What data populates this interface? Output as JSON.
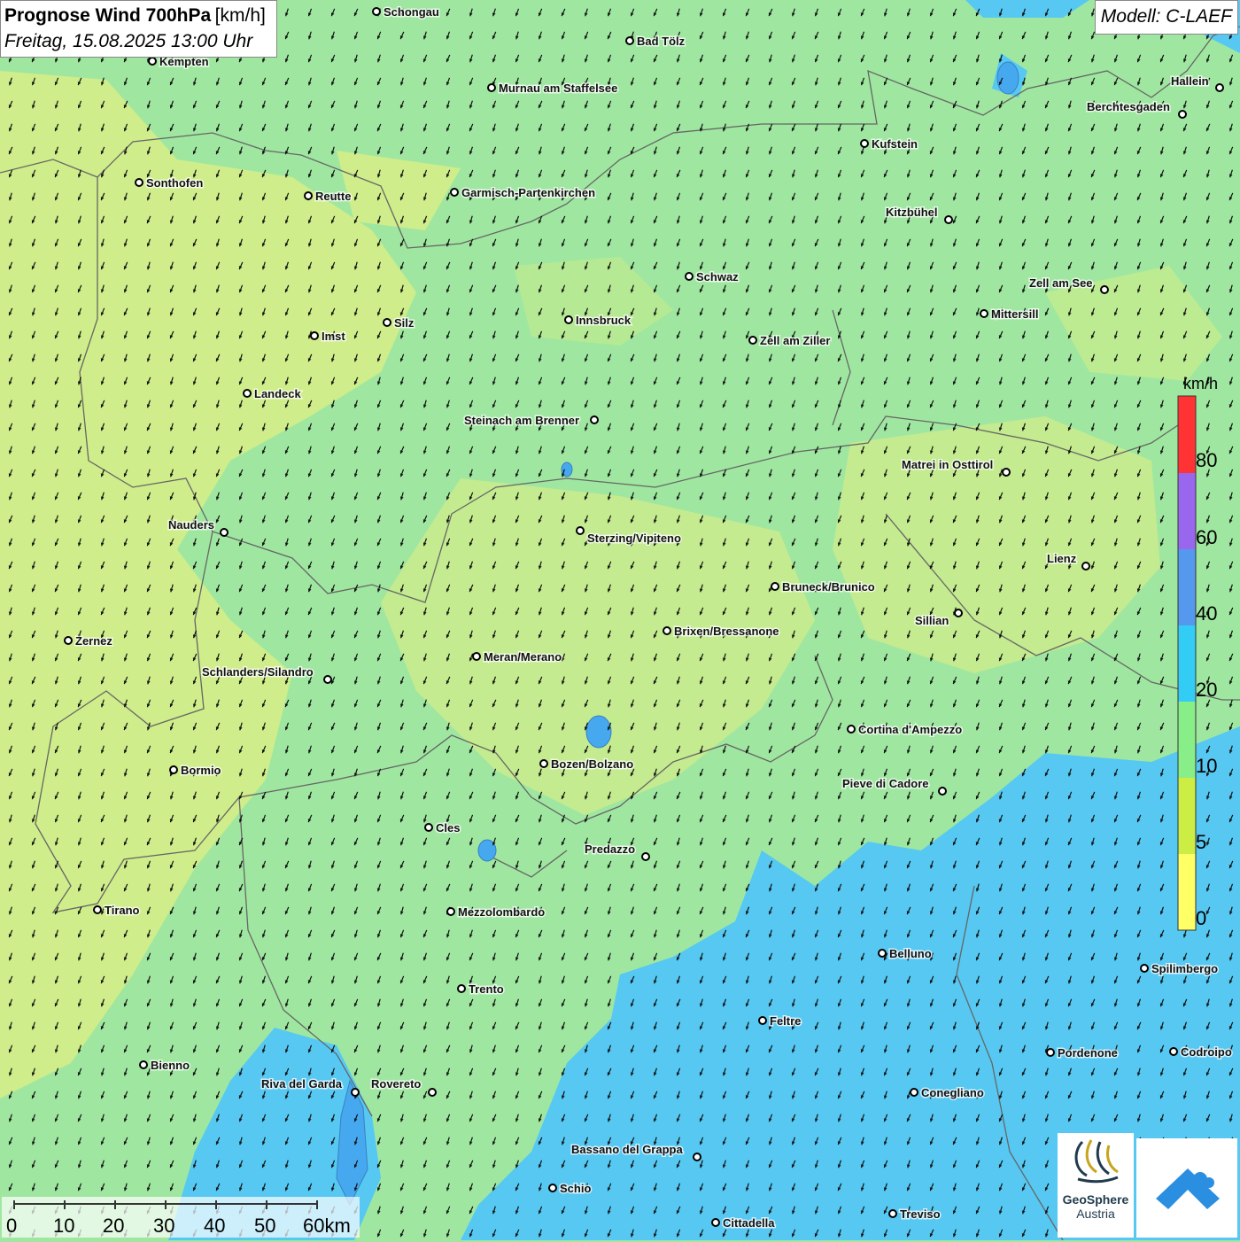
{
  "header": {
    "title": "Prognose Wind 700hPa",
    "unit": "[km/h]",
    "datetime": "Freitag, 15.08.2025 13:00 Uhr"
  },
  "model": {
    "label": "Modell: C-LAEF"
  },
  "legend": {
    "unit": "km/h",
    "ticks": [
      "80",
      "60",
      "40",
      "20",
      "10",
      "5",
      "0"
    ],
    "colors": [
      "#ff3333",
      "#9966ee",
      "#5599ee",
      "#33ccf5",
      "#88ee88",
      "#ccee44",
      "#ffff66"
    ]
  },
  "scalebar": {
    "labels": [
      "0",
      "10",
      "20",
      "30",
      "40",
      "50",
      "60km"
    ]
  },
  "logos": {
    "geosphere_name": "GeoSphere",
    "geosphere_country": "Austria"
  },
  "wind_direction": "north-north-east flow (arrows point south-south-west)",
  "cities": [
    {
      "name": "Schongau"
    },
    {
      "name": "Bad Tölz"
    },
    {
      "name": "Kempten"
    },
    {
      "name": "Murnau am Staffelsee"
    },
    {
      "name": "Hallein"
    },
    {
      "name": "Berchtesgaden"
    },
    {
      "name": "Kufstein"
    },
    {
      "name": "Sonthofen"
    },
    {
      "name": "Reutte"
    },
    {
      "name": "Garmisch-Partenkirchen"
    },
    {
      "name": "Kitzbühel"
    },
    {
      "name": "Schwaz"
    },
    {
      "name": "Zell am See"
    },
    {
      "name": "Mittersill"
    },
    {
      "name": "Silz"
    },
    {
      "name": "Innsbruck"
    },
    {
      "name": "Imst"
    },
    {
      "name": "Zell am Ziller"
    },
    {
      "name": "Landeck"
    },
    {
      "name": "Steinach am Brenner"
    },
    {
      "name": "Matrei in Osttirol"
    },
    {
      "name": "Nauders"
    },
    {
      "name": "Sterzing/Vipiteno"
    },
    {
      "name": "Lienz"
    },
    {
      "name": "Bruneck/Brunico"
    },
    {
      "name": "Sillian"
    },
    {
      "name": "Brixen/Bressanone"
    },
    {
      "name": "Zernez"
    },
    {
      "name": "Meran/Merano"
    },
    {
      "name": "Schlanders/Silandro"
    },
    {
      "name": "Cortina d'Ampezzo"
    },
    {
      "name": "Bozen/Bolzano"
    },
    {
      "name": "Bormio"
    },
    {
      "name": "Pieve di Cadore"
    },
    {
      "name": "Cles"
    },
    {
      "name": "Predazzo"
    },
    {
      "name": "Tirano"
    },
    {
      "name": "Mezzolombardo"
    },
    {
      "name": "Belluno"
    },
    {
      "name": "Spilimbergo"
    },
    {
      "name": "Trento"
    },
    {
      "name": "Feltre"
    },
    {
      "name": "Pordenone"
    },
    {
      "name": "Codroipo"
    },
    {
      "name": "Bienno"
    },
    {
      "name": "Riva del Garda"
    },
    {
      "name": "Rovereto"
    },
    {
      "name": "Conegliano"
    },
    {
      "name": "Bassano del Grappa"
    },
    {
      "name": "Schio"
    },
    {
      "name": "Treviso"
    },
    {
      "name": "Cittadella"
    }
  ]
}
